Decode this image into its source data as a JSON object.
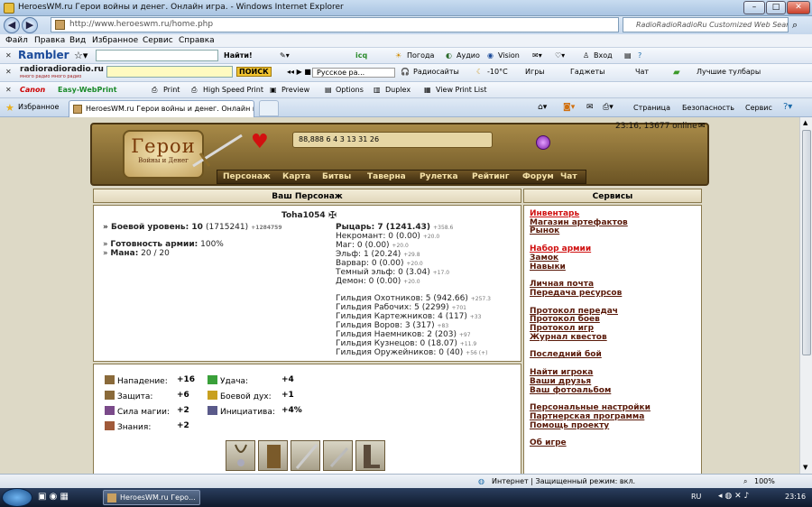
{
  "window": {
    "title": "HeroesWM.ru Герои войны и денег. Онлайн игра. - Windows Internet Explorer"
  },
  "address_bar": {
    "url": "http://www.heroeswm.ru/home.php",
    "search_placeholder": "RadioRadioRadioRu Customized Web Search"
  },
  "menu": [
    "Файл",
    "Правка",
    "Вид",
    "Избранное",
    "Сервис",
    "Справка"
  ],
  "toolbar_rambler": {
    "brand": "Rambler",
    "search_btn": "Найти!",
    "icq": "icq",
    "weather": "Погода",
    "audio": "Аудио",
    "vision": "Vision",
    "login": "Вход"
  },
  "toolbar_radio": {
    "brand": "radioradioradio.ru",
    "brand_sub": "много радио много радио",
    "search_btn": "ПОИСК",
    "station": "Русское ра...",
    "radio": "Радиосайты",
    "temp": "-10°C",
    "games": "Игры",
    "gadgets": "Гаджеты",
    "chat": "Чат",
    "best": "Лучшие тулбары"
  },
  "toolbar_canon": {
    "brand": "Canon",
    "app": "Easy-WebPrint",
    "print": "Print",
    "hs_print": "High Speed Print",
    "preview": "Preview",
    "options": "Options",
    "duplex": "Duplex",
    "view_list": "View Print List"
  },
  "favbar": {
    "favorites": "Избранное",
    "tab_title": "HeroesWM.ru Герои войны и денег. Онлайн иг...",
    "page": "Страница",
    "safety": "Безопасность",
    "service": "Сервис"
  },
  "game": {
    "logo_title": "Герои",
    "logo_sub": "Войны и Денег",
    "online": "23:16, 13677 online",
    "resources": "88,888  6  4  3  13  31  26",
    "nav": [
      "Персонаж",
      "Карта",
      "Битвы",
      "Таверна",
      "Рулетка",
      "Рейтинг",
      "Форум",
      "Чат"
    ],
    "char_header": "Ваш Персонаж",
    "services_header": "Сервисы",
    "nick": "Toha1054",
    "battle_level_label": "Боевой уровень:",
    "battle_level_val": "10",
    "battle_level_exp": "(1715241)",
    "battle_level_add": "+1284759",
    "army_ready_label": "Готовность армии:",
    "army_ready_val": "100%",
    "mana_label": "Мана:",
    "mana_val": "20 / 20",
    "factions": [
      {
        "name": "Рыцарь:",
        "val": "7 (1241.43)",
        "add": "+358.6",
        "bold": true
      },
      {
        "name": "Некромант:",
        "val": "0 (0.00)",
        "add": "+20.0",
        "bold": false
      },
      {
        "name": "Маг:",
        "val": "0 (0.00)",
        "add": "+20.0",
        "bold": false
      },
      {
        "name": "Эльф:",
        "val": "1 (20.24)",
        "add": "+29.8",
        "bold": false
      },
      {
        "name": "Варвар:",
        "val": "0 (0.00)",
        "add": "+20.0",
        "bold": false
      },
      {
        "name": "Темный эльф:",
        "val": "0 (3.04)",
        "add": "+17.0",
        "bold": false
      },
      {
        "name": "Демон:",
        "val": "0 (0.00)",
        "add": "+20.0",
        "bold": false
      }
    ],
    "guilds": [
      {
        "name": "Гильдия Охотников:",
        "val": "5 (942.66)",
        "add": "+257.3"
      },
      {
        "name": "Гильдия Рабочих:",
        "val": "5 (2299)",
        "add": "+701"
      },
      {
        "name": "Гильдия Картежников:",
        "val": "4 (117)",
        "add": "+33"
      },
      {
        "name": "Гильдия Воров:",
        "val": "3 (317)",
        "add": "+83"
      },
      {
        "name": "Гильдия Наемников:",
        "val": "2 (203)",
        "add": "+97"
      },
      {
        "name": "Гильдия Кузнецов:",
        "val": "0 (18.07)",
        "add": "+11.9"
      },
      {
        "name": "Гильдия Оружейников:",
        "val": "0 (40)",
        "add": "+56 (+)"
      }
    ],
    "stats": [
      {
        "name": "Нападение:",
        "val": "+16",
        "icon": "attack-icon",
        "color": "#8a6a3a"
      },
      {
        "name": "Защита:",
        "val": "+6",
        "icon": "defense-icon",
        "color": "#8a6a3a"
      },
      {
        "name": "Сила магии:",
        "val": "+2",
        "icon": "magic-power-icon",
        "color": "#7a4a8a"
      },
      {
        "name": "Знания:",
        "val": "+2",
        "icon": "knowledge-icon",
        "color": "#a05a3a"
      }
    ],
    "stats2": [
      {
        "name": "Удача:",
        "val": "+4",
        "icon": "luck-icon",
        "color": "#3aa03a"
      },
      {
        "name": "Боевой дух:",
        "val": "+1",
        "icon": "morale-icon",
        "color": "#c8a020"
      },
      {
        "name": "Инициатива:",
        "val": "+4%",
        "icon": "initiative-icon",
        "color": "#5a5a8a"
      }
    ],
    "services": [
      {
        "label": "Инвентарь",
        "red": true,
        "gap": false
      },
      {
        "label": "Магазин артефактов",
        "red": false,
        "gap": false
      },
      {
        "label": "Рынок",
        "red": false,
        "gap": false
      },
      {
        "label": "Набор армии",
        "red": true,
        "gap": true
      },
      {
        "label": "Замок",
        "red": false,
        "gap": false
      },
      {
        "label": "Навыки",
        "red": false,
        "gap": false
      },
      {
        "label": "Личная почта",
        "red": false,
        "gap": true
      },
      {
        "label": "Передача ресурсов",
        "red": false,
        "gap": false
      },
      {
        "label": "Протокол передач",
        "red": false,
        "gap": true
      },
      {
        "label": "Протокол боев",
        "red": false,
        "gap": false
      },
      {
        "label": "Протокол игр",
        "red": false,
        "gap": false
      },
      {
        "label": "Журнал квестов",
        "red": false,
        "gap": false
      },
      {
        "label": "Последний бой",
        "red": false,
        "gap": true
      },
      {
        "label": "Найти игрока",
        "red": false,
        "gap": true
      },
      {
        "label": "Ваши друзья",
        "red": false,
        "gap": false
      },
      {
        "label": "Ваш фотоальбом",
        "red": false,
        "gap": false
      },
      {
        "label": "Персональные настройки",
        "red": false,
        "gap": true
      },
      {
        "label": "Партнерская программа",
        "red": false,
        "gap": false
      },
      {
        "label": "Помощь проекту",
        "red": false,
        "gap": false
      },
      {
        "label": "Об игре",
        "red": false,
        "gap": true
      }
    ]
  },
  "status": {
    "zone": "Интернет | Защищенный режим: вкл.",
    "zoom": "100%"
  },
  "taskbar": {
    "item": "HeroesWM.ru Геро...",
    "lang": "RU",
    "time": "23:16"
  }
}
